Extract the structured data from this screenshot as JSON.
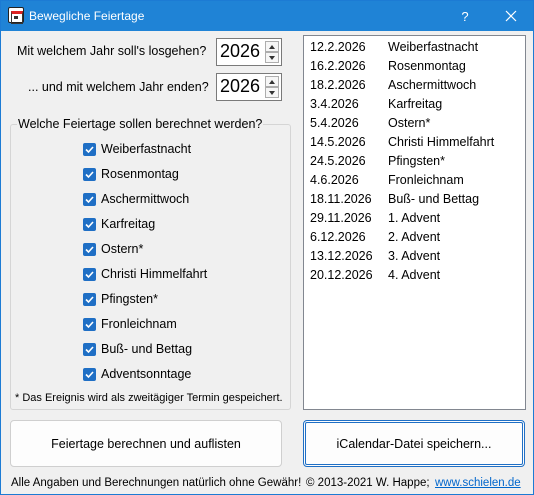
{
  "window": {
    "title": "Bewegliche Feiertage",
    "help": "?"
  },
  "start": {
    "label": "Mit welchem Jahr soll's losgehen?",
    "value": "2026"
  },
  "end": {
    "label": "... und mit welchem Jahr enden?",
    "value": "2026"
  },
  "group": {
    "legend": "Welche Feiertage sollen berechnet werden?",
    "items": [
      {
        "label": "Weiberfastnacht",
        "checked": true
      },
      {
        "label": "Rosenmontag",
        "checked": true
      },
      {
        "label": "Aschermittwoch",
        "checked": true
      },
      {
        "label": "Karfreitag",
        "checked": true
      },
      {
        "label": "Ostern*",
        "checked": true
      },
      {
        "label": "Christi Himmelfahrt",
        "checked": true
      },
      {
        "label": "Pfingsten*",
        "checked": true
      },
      {
        "label": "Fronleichnam",
        "checked": true
      },
      {
        "label": "Buß- und Bettag",
        "checked": true
      },
      {
        "label": "Adventsonntage",
        "checked": true
      }
    ],
    "note": "* Das Ereignis wird als zweitägiger Termin gespeichert."
  },
  "results": [
    {
      "date": "12.2.2026",
      "name": "Weiberfastnacht"
    },
    {
      "date": "16.2.2026",
      "name": "Rosenmontag"
    },
    {
      "date": "18.2.2026",
      "name": "Aschermittwoch"
    },
    {
      "date": "3.4.2026",
      "name": "Karfreitag"
    },
    {
      "date": "5.4.2026",
      "name": "Ostern*"
    },
    {
      "date": "14.5.2026",
      "name": "Christi Himmelfahrt"
    },
    {
      "date": "24.5.2026",
      "name": "Pfingsten*"
    },
    {
      "date": "4.6.2026",
      "name": "Fronleichnam"
    },
    {
      "date": "18.11.2026",
      "name": "Buß- und Bettag"
    },
    {
      "date": "29.11.2026",
      "name": "1. Advent"
    },
    {
      "date": "6.12.2026",
      "name": "2. Advent"
    },
    {
      "date": "13.12.2026",
      "name": "3. Advent"
    },
    {
      "date": "20.12.2026",
      "name": "4. Advent"
    }
  ],
  "buttons": {
    "calculate": "Feiertage berechnen und auflisten",
    "ical": "iCalendar-Datei speichern..."
  },
  "footer": {
    "disclaimer": "Alle Angaben und Berechnungen natürlich ohne Gewähr!",
    "copyright": "© 2013-2021 W. Happe;",
    "link": "www.schielen.de"
  },
  "colors": {
    "titlebar": "#1f83d6",
    "checkbox": "#1f6fc5",
    "link": "#0066cc"
  }
}
